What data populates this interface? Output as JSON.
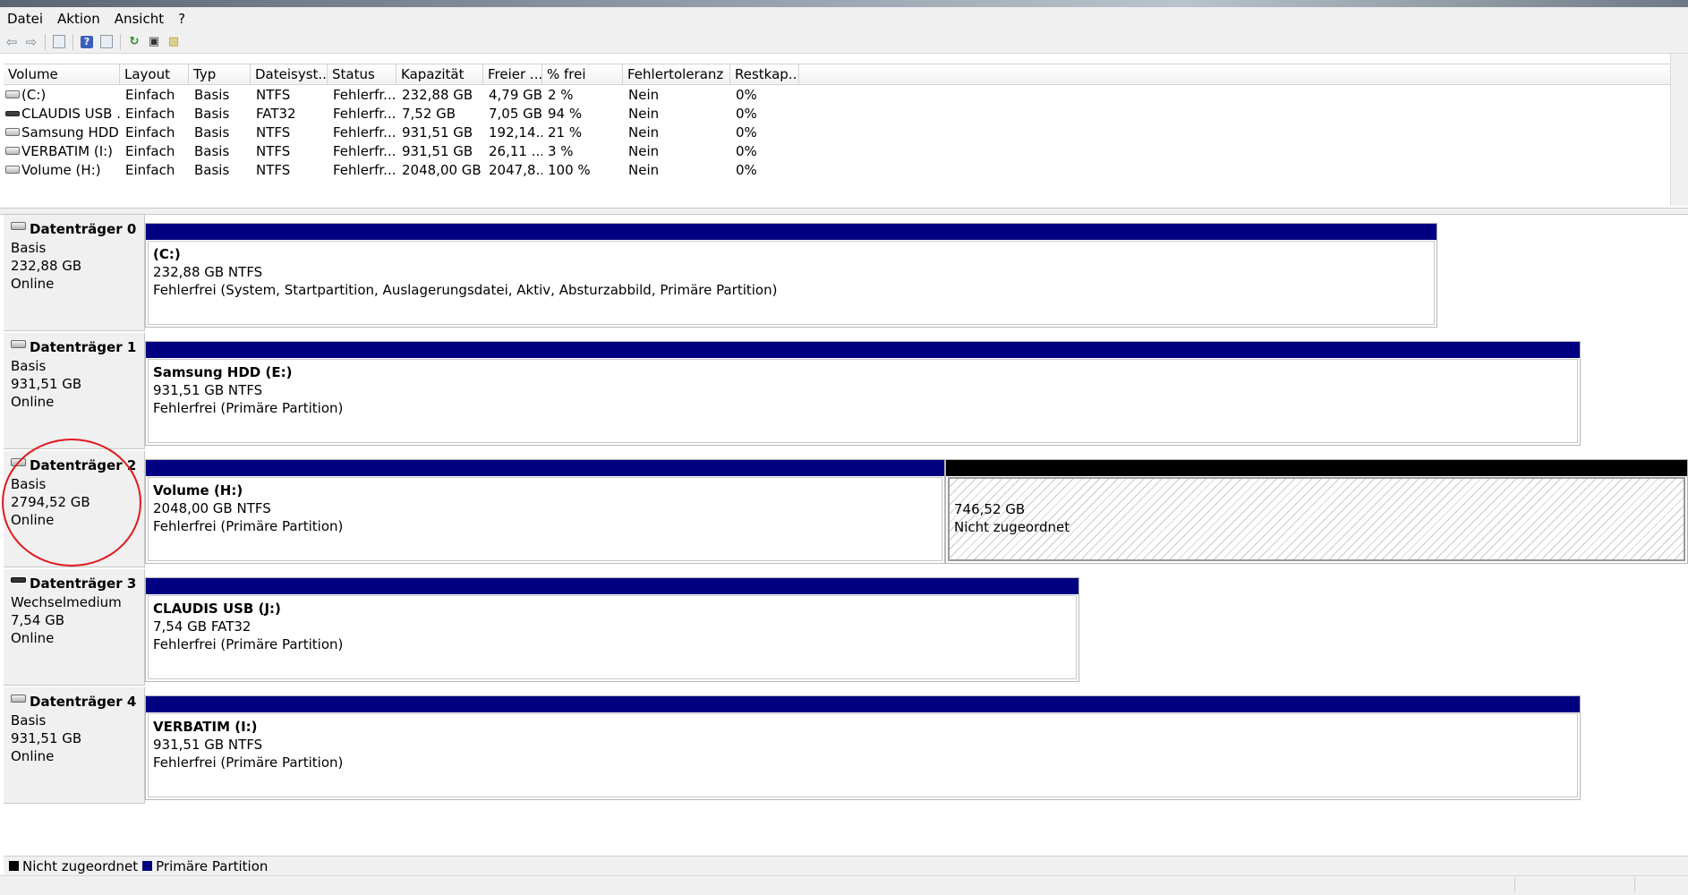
{
  "menu": [
    "Datei",
    "Aktion",
    "Ansicht",
    "?"
  ],
  "toolbar_icons": [
    "back-arrow-icon",
    "forward-arrow-icon",
    "console-tree-icon",
    "help-icon",
    "properties-view-icon",
    "refresh-icon",
    "properties-icon",
    "error-icon"
  ],
  "table": {
    "columns": [
      "Volume",
      "Layout",
      "Typ",
      "Dateisyst...",
      "Status",
      "Kapazität",
      "Freier ...",
      "% frei",
      "Fehlertoleranz",
      "Restkap..."
    ],
    "rows": [
      {
        "volume": "(C:)",
        "layout": "Einfach",
        "typ": "Basis",
        "fs": "NTFS",
        "status": "Fehlerfr...",
        "kap": "232,88 GB",
        "frei": "4,79 GB",
        "pct": "2 %",
        "fehlertol": "Nein",
        "rest": "0%",
        "icon": "hdd"
      },
      {
        "volume": "CLAUDIS USB ...",
        "layout": "Einfach",
        "typ": "Basis",
        "fs": "FAT32",
        "status": "Fehlerfr...",
        "kap": "7,52 GB",
        "frei": "7,05 GB",
        "pct": "94 %",
        "fehlertol": "Nein",
        "rest": "0%",
        "icon": "usb"
      },
      {
        "volume": "Samsung HDD...",
        "layout": "Einfach",
        "typ": "Basis",
        "fs": "NTFS",
        "status": "Fehlerfr...",
        "kap": "931,51 GB",
        "frei": "192,14...",
        "pct": "21 %",
        "fehlertol": "Nein",
        "rest": "0%",
        "icon": "hdd"
      },
      {
        "volume": "VERBATIM (I:)",
        "layout": "Einfach",
        "typ": "Basis",
        "fs": "NTFS",
        "status": "Fehlerfr...",
        "kap": "931,51 GB",
        "frei": "26,11 ...",
        "pct": "3 %",
        "fehlertol": "Nein",
        "rest": "0%",
        "icon": "hdd"
      },
      {
        "volume": "Volume (H:)",
        "layout": "Einfach",
        "typ": "Basis",
        "fs": "NTFS",
        "status": "Fehlerfr...",
        "kap": "2048,00 GB",
        "frei": "2047,8...",
        "pct": "100 %",
        "fehlertol": "Nein",
        "rest": "0%",
        "icon": "hdd"
      }
    ]
  },
  "disks": [
    {
      "name": "Datenträger 0",
      "type": "Basis",
      "size": "232,88 GB",
      "state": "Online",
      "icon": "hdd",
      "partitions": [
        {
          "label": "(C:)",
          "size": "232,88 GB NTFS",
          "status": "Fehlerfrei (System, Startpartition, Auslagerungsdatei, Aktiv, Absturzabbild, Primäre Partition)",
          "kind": "primary"
        }
      ]
    },
    {
      "name": "Datenträger 1",
      "type": "Basis",
      "size": "931,51 GB",
      "state": "Online",
      "icon": "hdd",
      "partitions": [
        {
          "label": "Samsung HDD  (E:)",
          "size": "931,51 GB NTFS",
          "status": "Fehlerfrei (Primäre Partition)",
          "kind": "primary"
        }
      ]
    },
    {
      "name": "Datenträger 2",
      "type": "Basis",
      "size": "2794,52 GB",
      "state": "Online",
      "icon": "hdd",
      "partitions": [
        {
          "label": "Volume  (H:)",
          "size": "2048,00 GB NTFS",
          "status": "Fehlerfrei (Primäre Partition)",
          "kind": "primary"
        },
        {
          "label": "",
          "size": "746,52 GB",
          "status": "Nicht zugeordnet",
          "kind": "unallocated"
        }
      ]
    },
    {
      "name": "Datenträger 3",
      "type": "Wechselmedium",
      "size": "7,54 GB",
      "state": "Online",
      "icon": "usb",
      "partitions": [
        {
          "label": "CLAUDIS USB  (J:)",
          "size": "7,54 GB FAT32",
          "status": "Fehlerfrei (Primäre Partition)",
          "kind": "primary"
        }
      ]
    },
    {
      "name": "Datenträger 4",
      "type": "Basis",
      "size": "931,51 GB",
      "state": "Online",
      "icon": "hdd",
      "partitions": [
        {
          "label": "VERBATIM  (I:)",
          "size": "931,51 GB NTFS",
          "status": "Fehlerfrei (Primäre Partition)",
          "kind": "primary"
        }
      ]
    }
  ],
  "legend": [
    {
      "label": "Nicht zugeordnet",
      "color": "#000000"
    },
    {
      "label": "Primäre Partition",
      "color": "#000080"
    }
  ],
  "colors": {
    "primary": "#000080",
    "unallocated": "#000000",
    "highlight_circle": "#e0191e"
  }
}
